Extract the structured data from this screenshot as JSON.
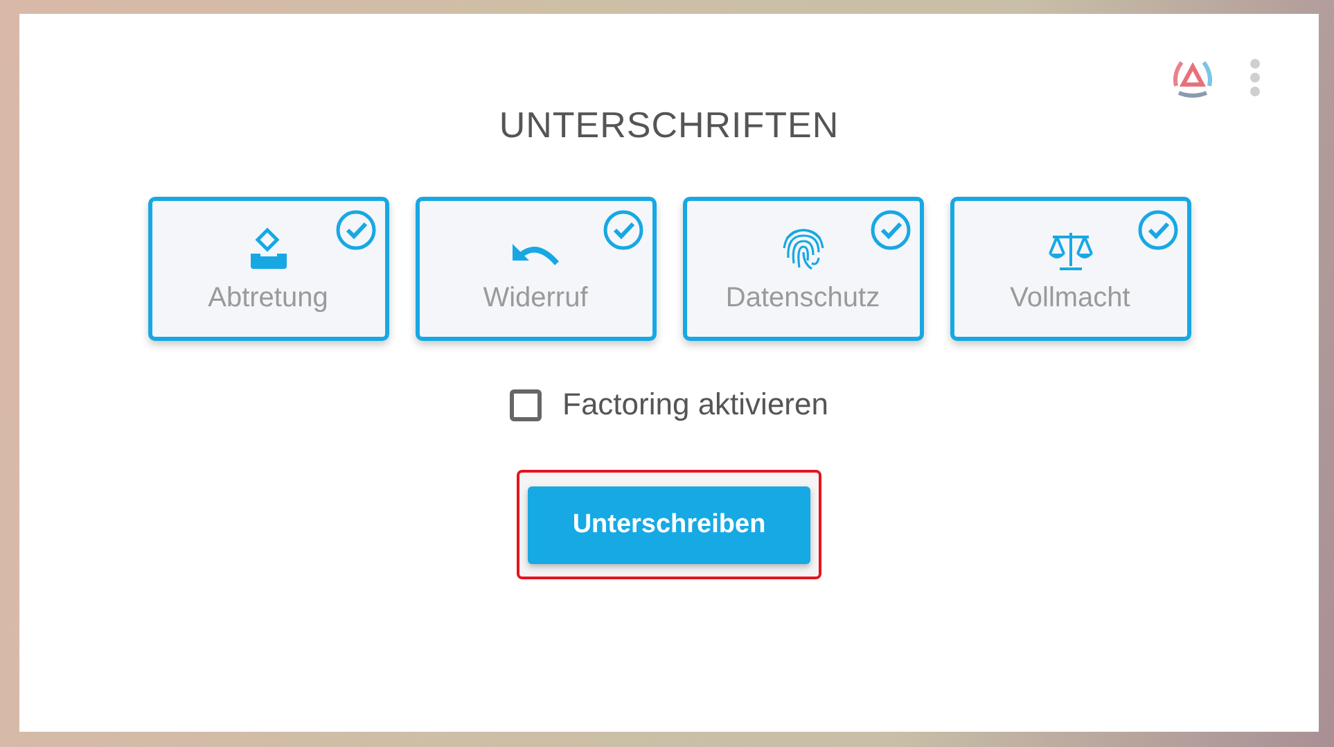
{
  "title": "UNTERSCHRIFTEN",
  "documents": [
    {
      "kind": "ballot",
      "label": "Abtretung",
      "checked": true
    },
    {
      "kind": "undo",
      "label": "Widerruf",
      "checked": true
    },
    {
      "kind": "fingerprint",
      "label": "Datenschutz",
      "checked": true
    },
    {
      "kind": "scales",
      "label": "Vollmacht",
      "checked": true
    }
  ],
  "factoring": {
    "label": "Factoring aktivieren",
    "checked": false
  },
  "submit": {
    "label": "Unterschreiben",
    "highlighted": true
  }
}
